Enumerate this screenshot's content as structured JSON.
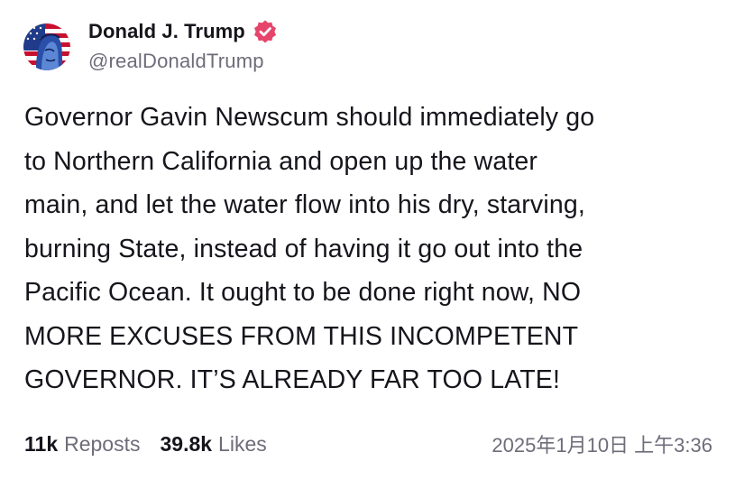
{
  "author": {
    "display_name": "Donald J. Trump",
    "handle": "@realDonaldTrump",
    "verified": true,
    "verified_badge_color": "#e6456b",
    "avatar_icon": "avatar-portrait-flag"
  },
  "post": {
    "lines": [
      "Governor Gavin Newscum should immediately go",
      "to Northern California and open up the water",
      "main, and let the water flow into his dry, starving,",
      "burning State, instead of having it go out into the",
      "Pacific Ocean. It ought to be done right now, NO",
      "MORE EXCUSES FROM THIS INCOMPETENT",
      "GOVERNOR. IT’S ALREADY FAR TOO LATE!"
    ]
  },
  "stats": {
    "reposts_count": "11k",
    "reposts_label": "Reposts",
    "likes_count": "39.8k",
    "likes_label": "Likes"
  },
  "timestamp": "2025年1月10日 上午3:36",
  "colors": {
    "text_primary": "#16151c",
    "text_secondary": "#6f6c7a",
    "background": "#ffffff"
  }
}
